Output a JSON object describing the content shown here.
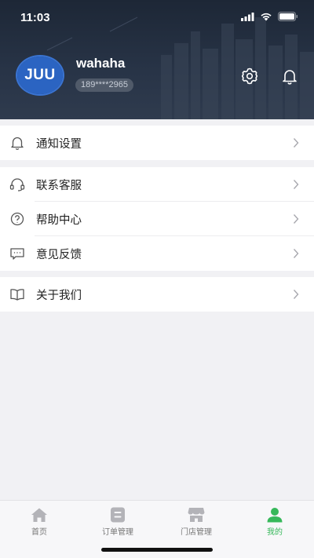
{
  "status_bar": {
    "time": "11:03"
  },
  "profile": {
    "avatar_text": "JUU",
    "username": "wahaha",
    "phone": "189****2965"
  },
  "header_actions": [
    {
      "icon": "gear-icon"
    },
    {
      "icon": "bell-icon"
    }
  ],
  "menu": {
    "notify": {
      "label": "通知设置",
      "icon": "bell-outline-icon"
    },
    "service": {
      "label": "联系客服",
      "icon": "headset-icon"
    },
    "help": {
      "label": "帮助中心",
      "icon": "help-icon"
    },
    "feedback": {
      "label": "意见反馈",
      "icon": "message-icon"
    },
    "about": {
      "label": "关于我们",
      "icon": "book-icon"
    }
  },
  "tabs": [
    {
      "label": "首页",
      "icon": "home-icon"
    },
    {
      "label": "订单管理",
      "icon": "order-icon"
    },
    {
      "label": "门店管理",
      "icon": "store-icon"
    },
    {
      "label": "我的",
      "icon": "profile-icon",
      "active": true
    }
  ],
  "colors": {
    "accent": "#36b85a",
    "header_bg": "#253042",
    "avatar_bg": "#2b64c2"
  }
}
